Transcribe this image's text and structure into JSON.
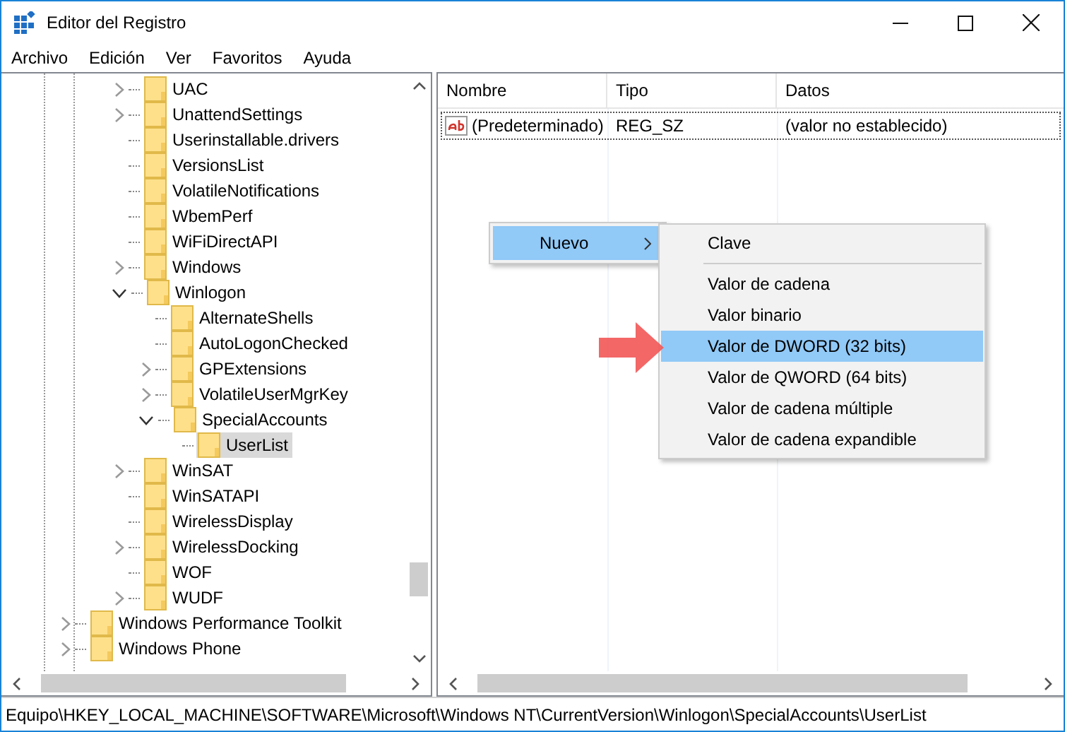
{
  "window": {
    "title": "Editor del Registro"
  },
  "menu_bar": [
    "Archivo",
    "Edición",
    "Ver",
    "Favoritos",
    "Ayuda"
  ],
  "tree": {
    "items": [
      {
        "label": "UAC",
        "expanded": false,
        "selected": false
      },
      {
        "label": "UnattendSettings",
        "expanded": false,
        "selected": false
      },
      {
        "label": "Userinstallable.drivers",
        "selected": false
      },
      {
        "label": "VersionsList",
        "selected": false
      },
      {
        "label": "VolatileNotifications",
        "selected": false
      },
      {
        "label": "WbemPerf",
        "selected": false
      },
      {
        "label": "WiFiDirectAPI",
        "selected": false
      },
      {
        "label": "Windows",
        "expanded": false,
        "selected": false
      },
      {
        "label": "Winlogon",
        "expanded": true,
        "selected": false,
        "children": [
          {
            "label": "AlternateShells",
            "selected": false
          },
          {
            "label": "AutoLogonChecked",
            "selected": false
          },
          {
            "label": "GPExtensions",
            "expanded": false,
            "selected": false
          },
          {
            "label": "VolatileUserMgrKey",
            "expanded": false,
            "selected": false
          },
          {
            "label": "SpecialAccounts",
            "expanded": true,
            "selected": false,
            "children": [
              {
                "label": "UserList",
                "selected": true
              }
            ]
          }
        ]
      },
      {
        "label": "WinSAT",
        "expanded": false,
        "selected": false
      },
      {
        "label": "WinSATAPI",
        "selected": false
      },
      {
        "label": "WirelessDisplay",
        "selected": false
      },
      {
        "label": "WirelessDocking",
        "expanded": false,
        "selected": false
      },
      {
        "label": "WOF",
        "selected": false
      },
      {
        "label": "WUDF",
        "expanded": false,
        "selected": false
      }
    ],
    "following_items": [
      {
        "label": "Windows Performance Toolkit",
        "expanded": false,
        "selected": false
      },
      {
        "label": "Windows Phone",
        "expanded": false,
        "selected": false
      }
    ]
  },
  "table": {
    "columns": [
      "Nombre",
      "Tipo",
      "Datos"
    ],
    "rows": [
      {
        "cells": [
          "(Predeterminado)",
          "REG_SZ",
          "(valor no establecido)"
        ]
      }
    ]
  },
  "context_menu": {
    "items": [
      {
        "label": "Nuevo",
        "selected": true
      }
    ]
  },
  "submenu": {
    "items": [
      {
        "kind": "item",
        "label": "Clave",
        "selected": false
      },
      {
        "kind": "separator"
      },
      {
        "kind": "item",
        "label": "Valor de cadena",
        "selected": false
      },
      {
        "kind": "item",
        "label": "Valor binario",
        "selected": false
      },
      {
        "kind": "item",
        "label": "Valor de DWORD (32 bits)",
        "selected": true
      },
      {
        "kind": "item",
        "label": "Valor de QWORD (64 bits)",
        "selected": false
      },
      {
        "kind": "item",
        "label": "Valor de cadena múltiple",
        "selected": false
      },
      {
        "kind": "item",
        "label": "Valor de cadena expandible",
        "selected": false
      }
    ]
  },
  "status_bar": "Equipo\\HKEY_LOCAL_MACHINE\\SOFTWARE\\Microsoft\\Windows NT\\CurrentVersion\\Winlogon\\SpecialAccounts\\UserList"
}
